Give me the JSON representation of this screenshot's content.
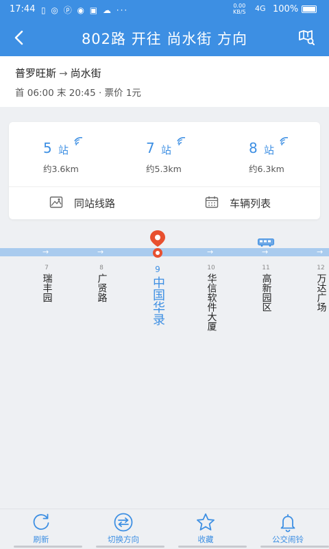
{
  "status_bar": {
    "time": "17:44",
    "net_speed_value": "0.00",
    "net_speed_unit": "KB/S",
    "signal": "4G",
    "battery": "100%"
  },
  "header": {
    "title": "802路 开往 尚水街 方向",
    "back_icon": "chevron-left-icon",
    "map_icon": "map-search-icon"
  },
  "route": {
    "from": "普罗旺斯",
    "arrow": "→",
    "to": "尚水街",
    "schedule": "首 06:00 末 20:45 · 票价 1元"
  },
  "arrivals": [
    {
      "count": "5",
      "unit": "站",
      "distance": "约3.6km"
    },
    {
      "count": "7",
      "unit": "站",
      "distance": "约5.3km"
    },
    {
      "count": "8",
      "unit": "站",
      "distance": "约6.3km"
    }
  ],
  "actions": {
    "same_station": "同站线路",
    "vehicle_list": "车辆列表"
  },
  "stops": [
    {
      "num": "7",
      "name": "瑞丰园"
    },
    {
      "num": "8",
      "name": "广贤路"
    },
    {
      "num": "9",
      "name": "中国华录"
    },
    {
      "num": "10",
      "name": "华信软件大厦"
    },
    {
      "num": "11",
      "name": "高新园区"
    },
    {
      "num": "12",
      "name": "万达广场"
    }
  ],
  "direction_arrow": "→",
  "nav": [
    {
      "label": "刷新",
      "icon": "refresh-icon"
    },
    {
      "label": "切换方向",
      "icon": "switch-direction-icon"
    },
    {
      "label": "收藏",
      "icon": "star-icon"
    },
    {
      "label": "公交闹铃",
      "icon": "bell-icon"
    }
  ],
  "colors": {
    "primary": "#3d8fe3",
    "route_line": "#a9cbee",
    "pin": "#e8502f",
    "background": "#eef0f3"
  }
}
